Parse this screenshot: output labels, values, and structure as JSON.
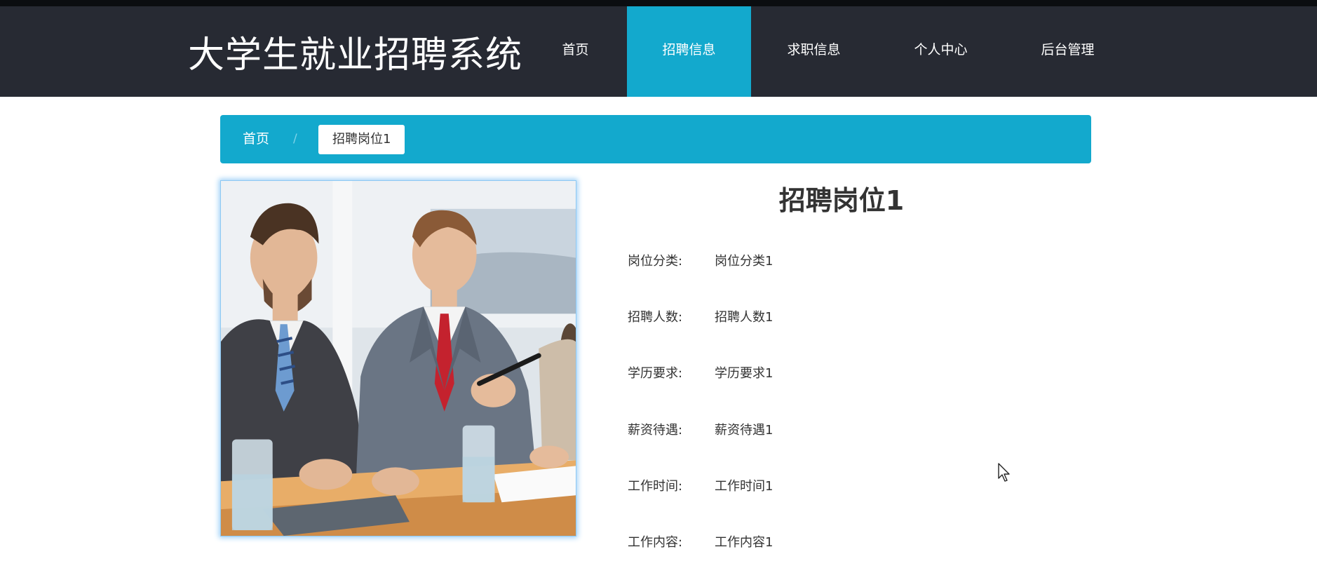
{
  "header": {
    "site_title": "大学生就业招聘系统",
    "nav": [
      {
        "label": "首页",
        "active": false
      },
      {
        "label": "招聘信息",
        "active": true
      },
      {
        "label": "求职信息",
        "active": false
      },
      {
        "label": "个人中心",
        "active": false
      },
      {
        "label": "后台管理",
        "active": false
      }
    ]
  },
  "breadcrumb": {
    "home": "首页",
    "separator": "/",
    "current": "招聘岗位1"
  },
  "job": {
    "title": "招聘岗位1",
    "details": [
      {
        "label": "岗位分类:",
        "value": "岗位分类1"
      },
      {
        "label": "招聘人数:",
        "value": "招聘人数1"
      },
      {
        "label": "学历要求:",
        "value": "学历要求1"
      },
      {
        "label": "薪资待遇:",
        "value": "薪资待遇1"
      },
      {
        "label": "工作时间:",
        "value": "工作时间1"
      },
      {
        "label": "工作内容:",
        "value": "工作内容1"
      }
    ]
  },
  "colors": {
    "header_bg": "#272a33",
    "accent": "#13a9cd",
    "text": "#333333"
  }
}
